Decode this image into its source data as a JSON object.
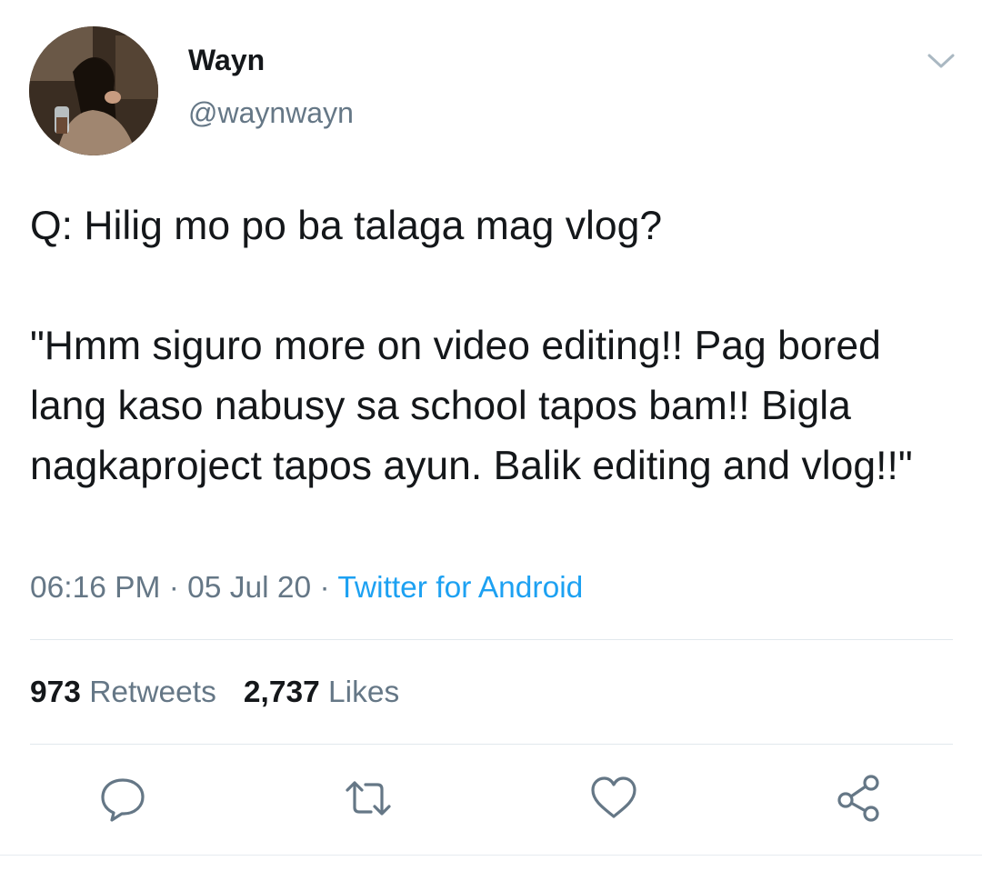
{
  "user": {
    "display_name": "Wayn",
    "handle": "@waynwayn"
  },
  "tweet": {
    "question": "Q: Hilig mo po ba talaga mag vlog?",
    "answer": "\"Hmm siguro more on video editing!! Pag bored lang kaso nabusy sa school tapos bam!! Bigla nagkaproject tapos ayun. Balik editing and vlog!!\"",
    "time": "06:16 PM",
    "separator": " · ",
    "date": "05 Jul 20",
    "source": "Twitter for Android"
  },
  "stats": {
    "retweets_count": "973",
    "retweets_label": "Retweets",
    "likes_count": "2,737",
    "likes_label": "Likes"
  },
  "actions": {
    "reply_icon": "reply-icon",
    "retweet_icon": "retweet-icon",
    "like_icon": "heart-icon",
    "share_icon": "share-icon"
  },
  "colors": {
    "text": "#14171a",
    "secondary": "#657786",
    "link": "#1da1f2",
    "divider": "#e1e8ed"
  }
}
